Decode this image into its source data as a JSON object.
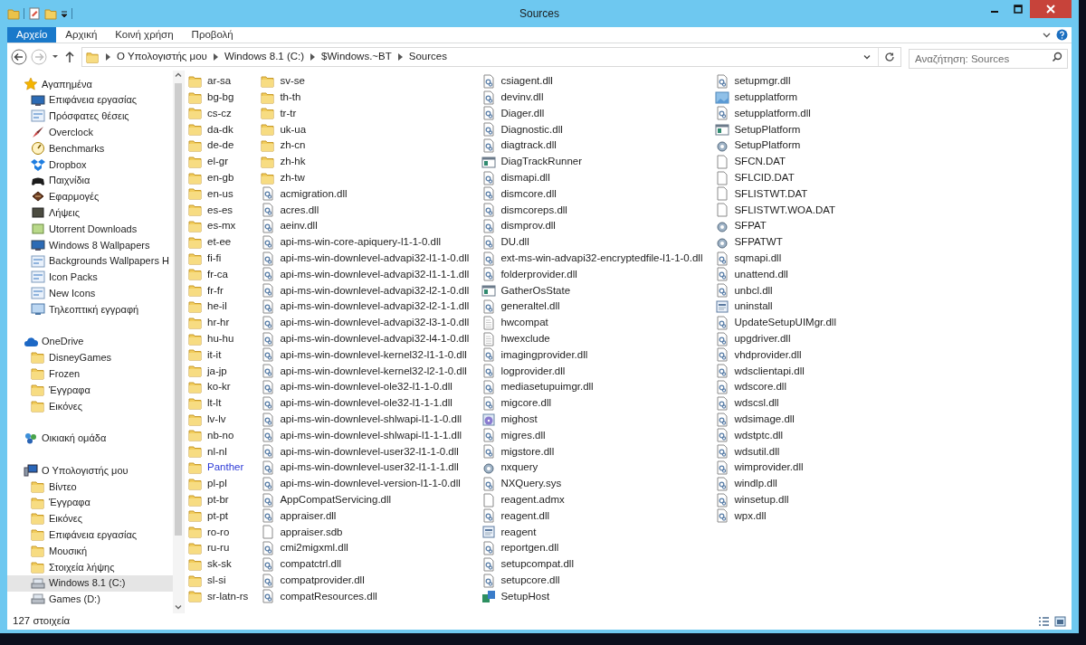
{
  "window": {
    "title": "Sources"
  },
  "ribbon_tabs": [
    {
      "label": "Αρχείο",
      "selected": true
    },
    {
      "label": "Αρχική",
      "selected": false
    },
    {
      "label": "Κοινή χρήση",
      "selected": false
    },
    {
      "label": "Προβολή",
      "selected": false
    }
  ],
  "address_bar": {
    "path": [
      "Ο Υπολογιστής μου",
      "Windows 8.1 (C:)",
      "$Windows.~BT",
      "Sources"
    ]
  },
  "search": {
    "placeholder": "Αναζήτηση: Sources"
  },
  "navigation": [
    {
      "label": "Αγαπημένα",
      "kind": "star",
      "selected": false,
      "children": [
        {
          "label": "Επιφάνεια εργασίας",
          "kind": "desktop",
          "selected": false
        },
        {
          "label": "Πρόσφατες θέσεις",
          "kind": "recent",
          "selected": false
        },
        {
          "label": "Overclock",
          "kind": "rocket",
          "selected": false
        },
        {
          "label": "Benchmarks",
          "kind": "gauge",
          "selected": false
        },
        {
          "label": "Dropbox",
          "kind": "dropbox",
          "selected": false
        },
        {
          "label": "Παιχνίδια",
          "kind": "gamepad",
          "selected": false
        },
        {
          "label": "Εφαρμογές",
          "kind": "apps",
          "selected": false
        },
        {
          "label": "Λήψεις",
          "kind": "dark-picture",
          "selected": false
        },
        {
          "label": "Utorrent Downloads",
          "kind": "green-picture",
          "selected": false
        },
        {
          "label": "Windows 8 Wallpapers",
          "kind": "desktop",
          "selected": false
        },
        {
          "label": "Backgrounds Wallpapers H",
          "kind": "recent",
          "selected": false
        },
        {
          "label": "Icon Packs",
          "kind": "recent",
          "selected": false
        },
        {
          "label": "New Icons",
          "kind": "recent",
          "selected": false
        },
        {
          "label": "Τηλεοπτική εγγραφή",
          "kind": "monitor",
          "selected": false
        }
      ]
    },
    {
      "label": "OneDrive",
      "kind": "cloud",
      "selected": false,
      "children": [
        {
          "label": "DisneyGames",
          "kind": "folder",
          "selected": false
        },
        {
          "label": "Frozen",
          "kind": "folder",
          "selected": false
        },
        {
          "label": "Έγγραφα",
          "kind": "folder",
          "selected": false
        },
        {
          "label": "Εικόνες",
          "kind": "folder",
          "selected": false
        }
      ]
    },
    {
      "label": "Οικιακή ομάδα",
      "kind": "homegroup",
      "selected": false
    },
    {
      "label": "Ο Υπολογιστής μου",
      "kind": "computer",
      "selected": false,
      "children": [
        {
          "label": "Βίντεο",
          "kind": "folder",
          "selected": false
        },
        {
          "label": "Έγγραφα",
          "kind": "folder",
          "selected": false
        },
        {
          "label": "Εικόνες",
          "kind": "folder",
          "selected": false
        },
        {
          "label": "Επιφάνεια εργασίας",
          "kind": "folder",
          "selected": false
        },
        {
          "label": "Μουσική",
          "kind": "folder",
          "selected": false
        },
        {
          "label": "Στοιχεία λήψης",
          "kind": "folder",
          "selected": false
        },
        {
          "label": "Windows 8.1 (C:)",
          "kind": "drive",
          "selected": true
        },
        {
          "label": "Games (D:)",
          "kind": "drive",
          "selected": false
        }
      ]
    }
  ],
  "files": [
    {
      "name": "ar-sa",
      "kind": "folder"
    },
    {
      "name": "bg-bg",
      "kind": "folder"
    },
    {
      "name": "cs-cz",
      "kind": "folder"
    },
    {
      "name": "da-dk",
      "kind": "folder"
    },
    {
      "name": "de-de",
      "kind": "folder"
    },
    {
      "name": "el-gr",
      "kind": "folder"
    },
    {
      "name": "en-gb",
      "kind": "folder"
    },
    {
      "name": "en-us",
      "kind": "folder"
    },
    {
      "name": "es-es",
      "kind": "folder"
    },
    {
      "name": "es-mx",
      "kind": "folder"
    },
    {
      "name": "et-ee",
      "kind": "folder"
    },
    {
      "name": "fi-fi",
      "kind": "folder"
    },
    {
      "name": "fr-ca",
      "kind": "folder"
    },
    {
      "name": "fr-fr",
      "kind": "folder"
    },
    {
      "name": "he-il",
      "kind": "folder"
    },
    {
      "name": "hr-hr",
      "kind": "folder"
    },
    {
      "name": "hu-hu",
      "kind": "folder"
    },
    {
      "name": "it-it",
      "kind": "folder"
    },
    {
      "name": "ja-jp",
      "kind": "folder"
    },
    {
      "name": "ko-kr",
      "kind": "folder"
    },
    {
      "name": "lt-lt",
      "kind": "folder"
    },
    {
      "name": "lv-lv",
      "kind": "folder"
    },
    {
      "name": "nb-no",
      "kind": "folder"
    },
    {
      "name": "nl-nl",
      "kind": "folder"
    },
    {
      "name": "Panther",
      "kind": "compressed-folder"
    },
    {
      "name": "pl-pl",
      "kind": "folder"
    },
    {
      "name": "pt-br",
      "kind": "folder"
    },
    {
      "name": "pt-pt",
      "kind": "folder"
    },
    {
      "name": "ro-ro",
      "kind": "folder"
    },
    {
      "name": "ru-ru",
      "kind": "folder"
    },
    {
      "name": "sk-sk",
      "kind": "folder"
    },
    {
      "name": "sl-si",
      "kind": "folder"
    },
    {
      "name": "sr-latn-rs",
      "kind": "folder"
    },
    {
      "name": "sv-se",
      "kind": "folder"
    },
    {
      "name": "th-th",
      "kind": "folder"
    },
    {
      "name": "tr-tr",
      "kind": "folder"
    },
    {
      "name": "uk-ua",
      "kind": "folder"
    },
    {
      "name": "zh-cn",
      "kind": "folder"
    },
    {
      "name": "zh-hk",
      "kind": "folder"
    },
    {
      "name": "zh-tw",
      "kind": "folder"
    },
    {
      "name": "acmigration.dll",
      "kind": "library"
    },
    {
      "name": "acres.dll",
      "kind": "library"
    },
    {
      "name": "aeinv.dll",
      "kind": "library"
    },
    {
      "name": "api-ms-win-core-apiquery-l1-1-0.dll",
      "kind": "library"
    },
    {
      "name": "api-ms-win-downlevel-advapi32-l1-1-0.dll",
      "kind": "library"
    },
    {
      "name": "api-ms-win-downlevel-advapi32-l1-1-1.dll",
      "kind": "library"
    },
    {
      "name": "api-ms-win-downlevel-advapi32-l2-1-0.dll",
      "kind": "library"
    },
    {
      "name": "api-ms-win-downlevel-advapi32-l2-1-1.dll",
      "kind": "library"
    },
    {
      "name": "api-ms-win-downlevel-advapi32-l3-1-0.dll",
      "kind": "library"
    },
    {
      "name": "api-ms-win-downlevel-advapi32-l4-1-0.dll",
      "kind": "library"
    },
    {
      "name": "api-ms-win-downlevel-kernel32-l1-1-0.dll",
      "kind": "library"
    },
    {
      "name": "api-ms-win-downlevel-kernel32-l2-1-0.dll",
      "kind": "library"
    },
    {
      "name": "api-ms-win-downlevel-ole32-l1-1-0.dll",
      "kind": "library"
    },
    {
      "name": "api-ms-win-downlevel-ole32-l1-1-1.dll",
      "kind": "library"
    },
    {
      "name": "api-ms-win-downlevel-shlwapi-l1-1-0.dll",
      "kind": "library"
    },
    {
      "name": "api-ms-win-downlevel-shlwapi-l1-1-1.dll",
      "kind": "library"
    },
    {
      "name": "api-ms-win-downlevel-user32-l1-1-0.dll",
      "kind": "library"
    },
    {
      "name": "api-ms-win-downlevel-user32-l1-1-1.dll",
      "kind": "library"
    },
    {
      "name": "api-ms-win-downlevel-version-l1-1-0.dll",
      "kind": "library"
    },
    {
      "name": "AppCompatServicing.dll",
      "kind": "library"
    },
    {
      "name": "appraiser.dll",
      "kind": "library"
    },
    {
      "name": "appraiser.sdb",
      "kind": "document"
    },
    {
      "name": "cmi2migxml.dll",
      "kind": "library"
    },
    {
      "name": "compatctrl.dll",
      "kind": "library"
    },
    {
      "name": "compatprovider.dll",
      "kind": "library"
    },
    {
      "name": "compatResources.dll",
      "kind": "library"
    },
    {
      "name": "csiagent.dll",
      "kind": "library"
    },
    {
      "name": "devinv.dll",
      "kind": "library"
    },
    {
      "name": "Diager.dll",
      "kind": "library"
    },
    {
      "name": "Diagnostic.dll",
      "kind": "library"
    },
    {
      "name": "diagtrack.dll",
      "kind": "library"
    },
    {
      "name": "DiagTrackRunner",
      "kind": "application"
    },
    {
      "name": "dismapi.dll",
      "kind": "library"
    },
    {
      "name": "dismcore.dll",
      "kind": "library"
    },
    {
      "name": "dismcoreps.dll",
      "kind": "library"
    },
    {
      "name": "dismprov.dll",
      "kind": "library"
    },
    {
      "name": "DU.dll",
      "kind": "library"
    },
    {
      "name": "ext-ms-win-advapi32-encryptedfile-l1-1-0.dll",
      "kind": "library"
    },
    {
      "name": "folderprovider.dll",
      "kind": "library"
    },
    {
      "name": "GatherOsState",
      "kind": "application"
    },
    {
      "name": "generaltel.dll",
      "kind": "library"
    },
    {
      "name": "hwcompat",
      "kind": "text"
    },
    {
      "name": "hwexclude",
      "kind": "text"
    },
    {
      "name": "imagingprovider.dll",
      "kind": "library"
    },
    {
      "name": "logprovider.dll",
      "kind": "library"
    },
    {
      "name": "mediasetupuimgr.dll",
      "kind": "library"
    },
    {
      "name": "migcore.dll",
      "kind": "library"
    },
    {
      "name": "mighost",
      "kind": "disc"
    },
    {
      "name": "migres.dll",
      "kind": "library"
    },
    {
      "name": "migstore.dll",
      "kind": "library"
    },
    {
      "name": "nxquery",
      "kind": "settings"
    },
    {
      "name": "NXQuery.sys",
      "kind": "library"
    },
    {
      "name": "reagent.admx",
      "kind": "document"
    },
    {
      "name": "reagent.dll",
      "kind": "library"
    },
    {
      "name": "reagent",
      "kind": "form"
    },
    {
      "name": "reportgen.dll",
      "kind": "library"
    },
    {
      "name": "setupcompat.dll",
      "kind": "library"
    },
    {
      "name": "setupcore.dll",
      "kind": "library"
    },
    {
      "name": "SetupHost",
      "kind": "installer"
    },
    {
      "name": "setupmgr.dll",
      "kind": "library"
    },
    {
      "name": "setupplatform",
      "kind": "picture"
    },
    {
      "name": "setupplatform.dll",
      "kind": "library"
    },
    {
      "name": "SetupPlatform",
      "kind": "application"
    },
    {
      "name": "SetupPlatform",
      "kind": "settings"
    },
    {
      "name": "SFCN.DAT",
      "kind": "document"
    },
    {
      "name": "SFLCID.DAT",
      "kind": "document"
    },
    {
      "name": "SFLISTWT.DAT",
      "kind": "document"
    },
    {
      "name": "SFLISTWT.WOA.DAT",
      "kind": "document"
    },
    {
      "name": "SFPAT",
      "kind": "settings"
    },
    {
      "name": "SFPATWT",
      "kind": "settings"
    },
    {
      "name": "sqmapi.dll",
      "kind": "library"
    },
    {
      "name": "unattend.dll",
      "kind": "library"
    },
    {
      "name": "unbcl.dll",
      "kind": "library"
    },
    {
      "name": "uninstall",
      "kind": "form"
    },
    {
      "name": "UpdateSetupUIMgr.dll",
      "kind": "library"
    },
    {
      "name": "upgdriver.dll",
      "kind": "library"
    },
    {
      "name": "vhdprovider.dll",
      "kind": "library"
    },
    {
      "name": "wdsclientapi.dll",
      "kind": "library"
    },
    {
      "name": "wdscore.dll",
      "kind": "library"
    },
    {
      "name": "wdscsl.dll",
      "kind": "library"
    },
    {
      "name": "wdsimage.dll",
      "kind": "library"
    },
    {
      "name": "wdstptc.dll",
      "kind": "library"
    },
    {
      "name": "wdsutil.dll",
      "kind": "library"
    },
    {
      "name": "wimprovider.dll",
      "kind": "library"
    },
    {
      "name": "windlp.dll",
      "kind": "library"
    },
    {
      "name": "winsetup.dll",
      "kind": "library"
    },
    {
      "name": "wpx.dll",
      "kind": "library"
    }
  ],
  "status_bar": {
    "item_count": "127 στοιχεία"
  }
}
